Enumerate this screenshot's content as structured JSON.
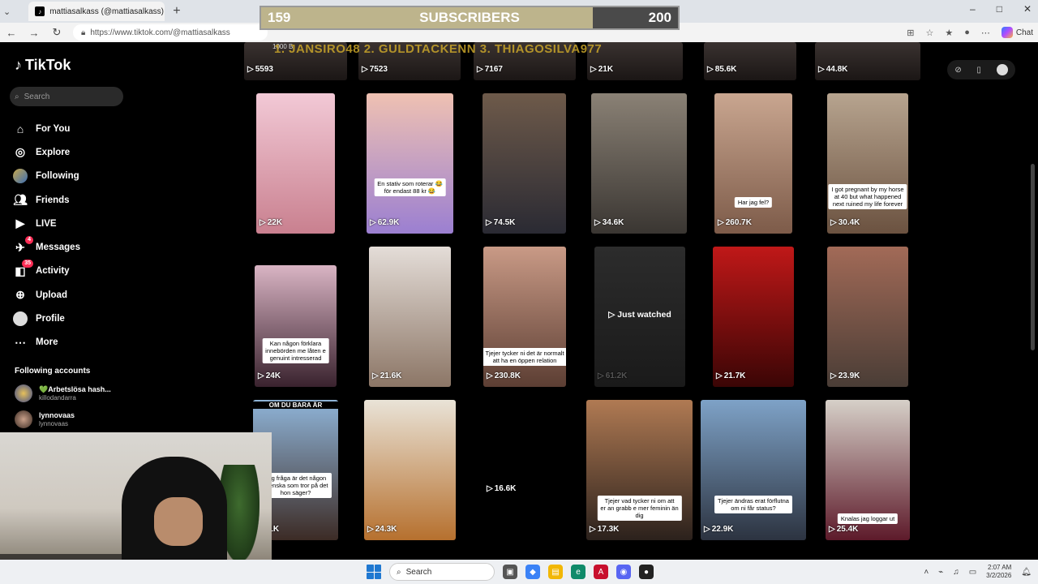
{
  "browser": {
    "tab_title": "mattiasalkass (@mattiasalkass) | Tik",
    "tab_close": "✕",
    "new_tab": "+",
    "url": "https://www.tiktok.com/@mattiasalkass",
    "chat_label": "Chat",
    "win_min": "–",
    "win_max": "□",
    "win_close": "✕",
    "back": "←",
    "forward": "→",
    "reload": "↻"
  },
  "sub_goal": {
    "current": "159",
    "title": "SUBSCRIBERS",
    "goal": "200",
    "progress": 0.795
  },
  "stream_overlay": {
    "winners_text": "1. JANSIRO48 2. GULDTACKENN 3. THIAGOSILVA977",
    "small_text": "1000 B"
  },
  "sidebar": {
    "logo_text": "TikTok",
    "search_placeholder": "Search",
    "nav": [
      {
        "label": "For You",
        "icon": "home-icon"
      },
      {
        "label": "Explore",
        "icon": "compass-icon"
      },
      {
        "label": "Following",
        "icon": "following-avatar-icon"
      },
      {
        "label": "Friends",
        "icon": "friends-icon"
      },
      {
        "label": "LIVE",
        "icon": "live-icon"
      },
      {
        "label": "Messages",
        "icon": "messages-icon",
        "badge": "4"
      },
      {
        "label": "Activity",
        "icon": "activity-icon",
        "badge": "35"
      },
      {
        "label": "Upload",
        "icon": "upload-icon"
      },
      {
        "label": "Profile",
        "icon": "profile-avatar-icon"
      },
      {
        "label": "More",
        "icon": "more-icon"
      }
    ],
    "following_title": "Following accounts",
    "following": [
      {
        "name": "💚Arbetslösa hash...",
        "handle": "killodandarra"
      },
      {
        "name": "lynnovaas",
        "handle": "lynnovaas"
      }
    ]
  },
  "videos_top_row": [
    "5593",
    "7523",
    "7167",
    "21K",
    "85.6K",
    "44.8K"
  ],
  "videos": [
    {
      "views": "22K",
      "caption": "",
      "bg": [
        "#f2c9d6",
        "#c9808f"
      ]
    },
    {
      "views": "62.9K",
      "caption": "En stativ som roterar 😂\nför endast 88 kr 😂",
      "bg": [
        "#efc1b2",
        "#9b7fd1"
      ]
    },
    {
      "views": "74.5K",
      "caption": "",
      "bg": [
        "#6e5a4a",
        "#2a2a33"
      ]
    },
    {
      "views": "34.6K",
      "caption": "",
      "bg": [
        "#8a8175",
        "#3a3632"
      ]
    },
    {
      "views": "260.7K",
      "caption": "Har jag fel?",
      "bg": [
        "#c9a690",
        "#7d5b49"
      ]
    },
    {
      "views": "30.4K",
      "caption": "I got pregnant by my horse\nat 40 but what happened\nnext ruined my life forever",
      "bg": [
        "#b7a48f",
        "#6b5240"
      ]
    },
    {
      "views": "24K",
      "caption": "Kan någon förklara\ninnebörden me låten e\ngenuint intresserad",
      "bg": [
        "#d9b4c4",
        "#39222e"
      ]
    },
    {
      "views": "21.6K",
      "caption": "",
      "bg": [
        "#e4ddd8",
        "#8c7666"
      ]
    },
    {
      "views": "230.8K",
      "caption": "Tjejer tycker ni det är normalt\natt ha en öppen relation",
      "bg": [
        "#c99a86",
        "#5c3e33"
      ]
    },
    {
      "views": "61.2K",
      "caption": "",
      "bg": [
        "#2c2c2c",
        "#1a1a1a"
      ],
      "just_watched": "Just watched"
    },
    {
      "views": "21.7K",
      "caption": "",
      "bg": [
        "#c01818",
        "#3a0505"
      ]
    },
    {
      "views": "23.9K",
      "caption": "",
      "bg": [
        "#a26a57",
        "#4a3d36"
      ]
    },
    {
      "views": "21K",
      "caption": "Jag fråga är det någon\nsvenska som tror på det\nhon säger?",
      "top_text": "OM DU BARA ÄR",
      "bg": [
        "#8fb4d8",
        "#3c2b25"
      ]
    },
    {
      "views": "24.3K",
      "caption": "",
      "bg": [
        "#e9e3d7",
        "#b6702e"
      ]
    },
    {
      "views": "16.6K",
      "caption": "",
      "bg": [
        "#000000",
        "#000000"
      ]
    },
    {
      "views": "17.3K",
      "caption": "Tjejer vad tycker ni om att\ner an grabb e mer feminin än\ndig",
      "bg": [
        "#b07a53",
        "#2b211c"
      ]
    },
    {
      "views": "22.9K",
      "caption": "Tjejer ändras erat förflutna\nom ni får status?",
      "bg": [
        "#7ea2c7",
        "#2c3340"
      ]
    },
    {
      "views": "25.4K",
      "caption": "Knalas jag loggar ut",
      "bg": [
        "#d6d0c8",
        "#5d1a2a"
      ]
    }
  ],
  "top_right": {
    "icon1": "⊘",
    "icon2": "▯"
  },
  "taskbar": {
    "search_label": "Search",
    "time": "2:07 AM",
    "date": "3/2/2026"
  }
}
